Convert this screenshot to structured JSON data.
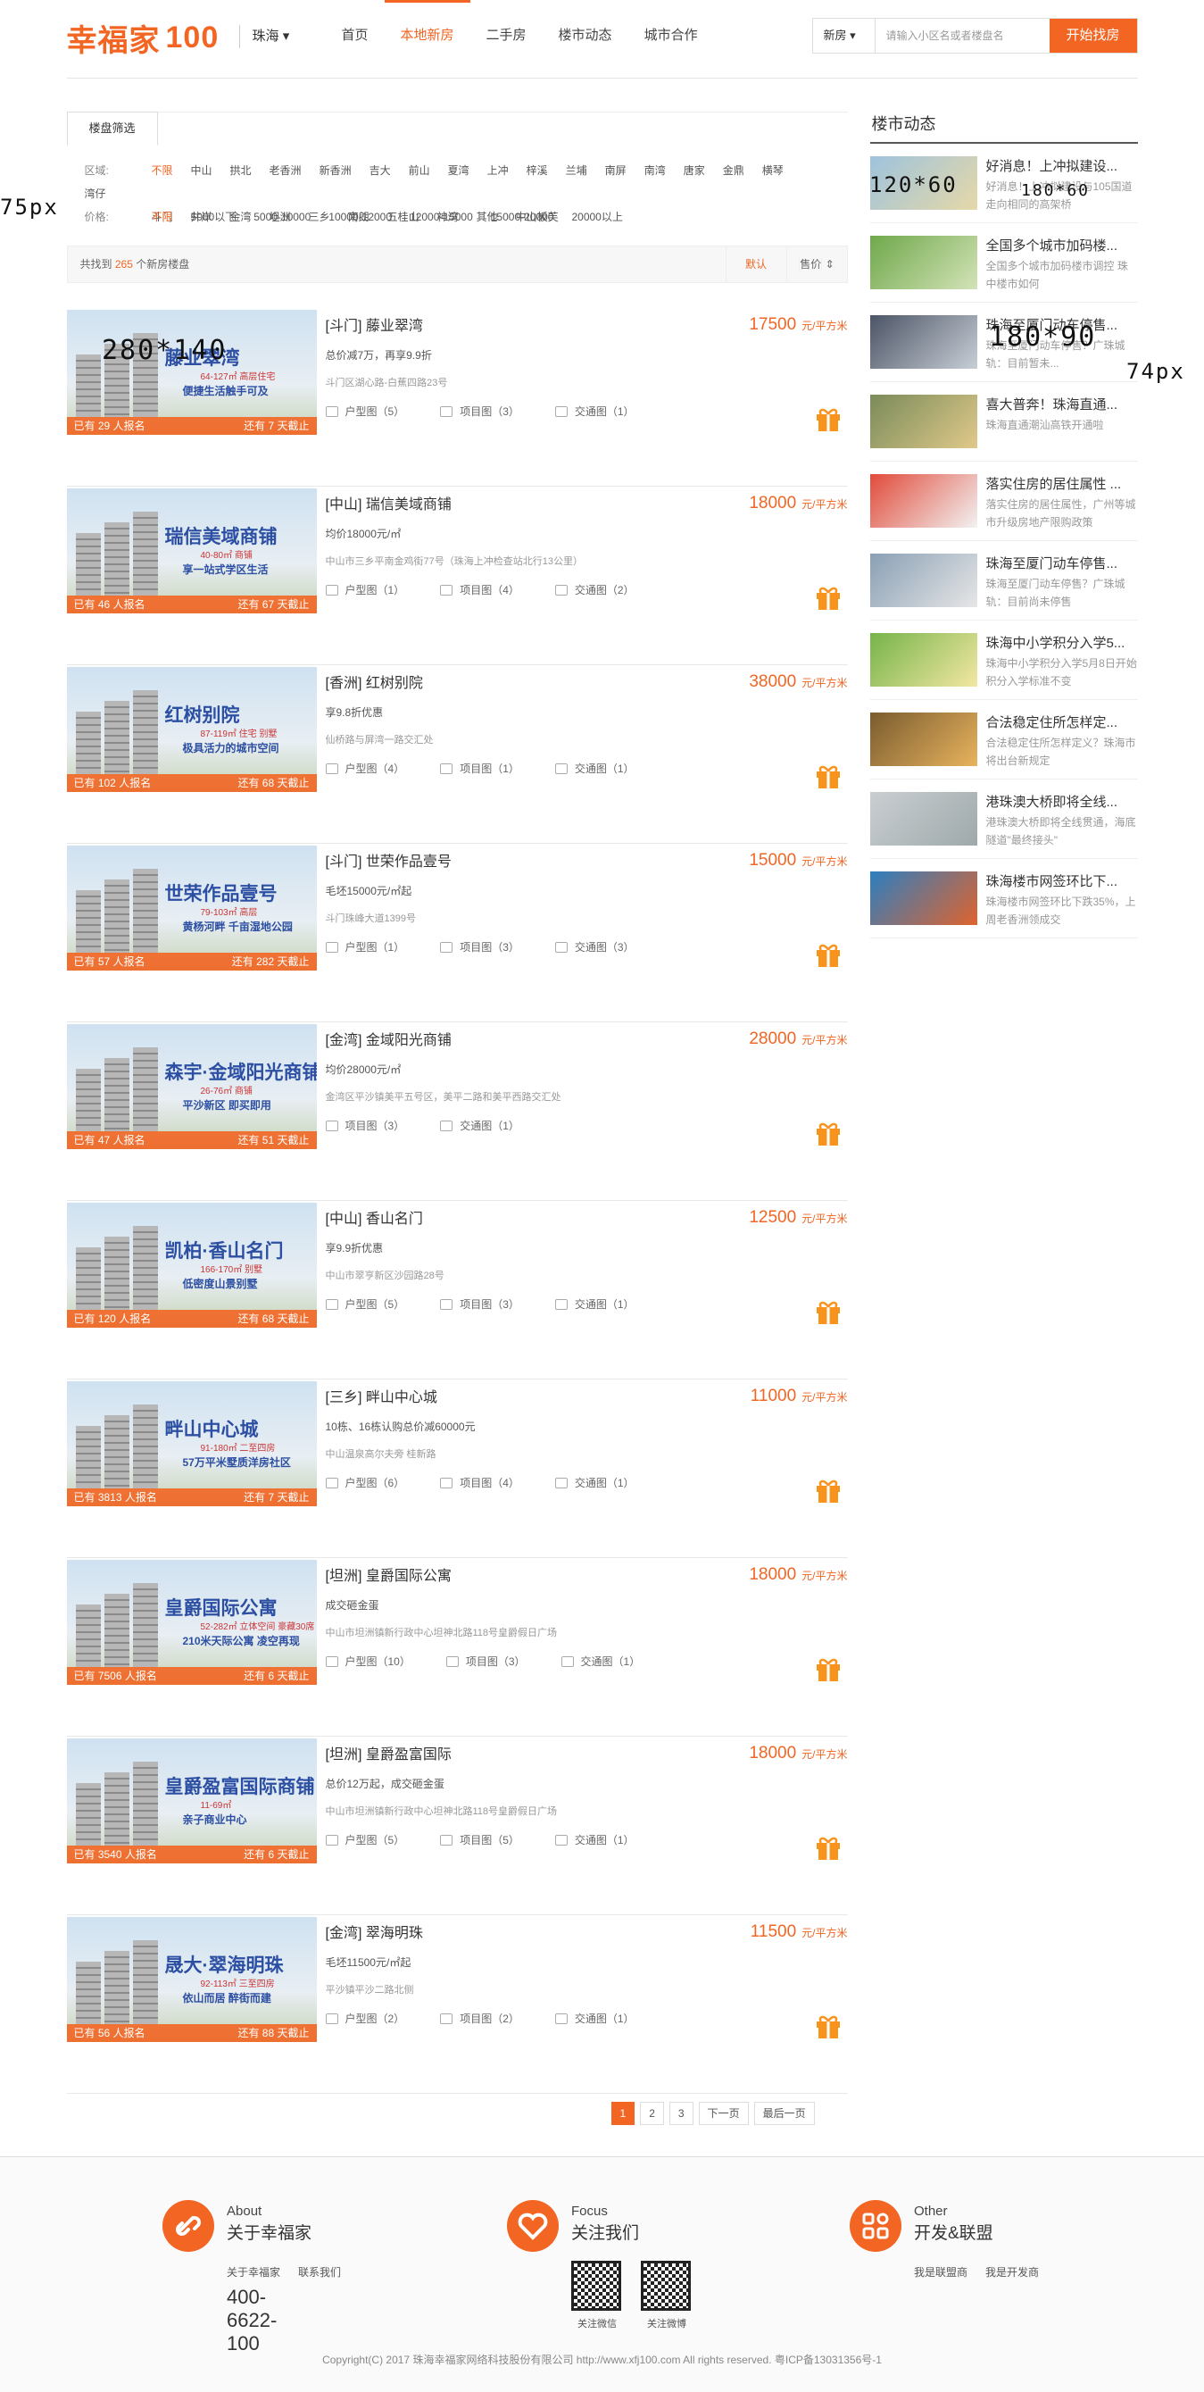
{
  "header": {
    "logo": "幸福家",
    "logo_num": "100",
    "city": "珠海",
    "nav": [
      "首页",
      "本地新房",
      "二手房",
      "楼市动态",
      "城市合作"
    ],
    "search": {
      "type": "新房",
      "placeholder": "请输入小区名或者楼盘名",
      "button": "开始找房"
    }
  },
  "filter": {
    "tab": "楼盘筛选",
    "area_label": "区域:",
    "areas": [
      "不限",
      "中山",
      "拱北",
      "老香洲",
      "新香洲",
      "吉大",
      "前山",
      "夏湾",
      "上冲",
      "梓溪",
      "兰埔",
      "南屏",
      "南湾",
      "唐家",
      "金鼎",
      "横琴",
      "湾仔",
      "斗门",
      "井岸",
      "金湾",
      "坦洲",
      "三乡",
      "南朗",
      "五桂山",
      "神湾",
      "其他",
      "中山板芙"
    ],
    "price_label": "价格:",
    "prices": [
      "不限",
      "5000以下",
      "5000-10000",
      "10000-12000",
      "12000-15000",
      "15000-20000",
      "20000以上"
    ],
    "found_pre": "共找到",
    "found_count": "265",
    "found_post": "个新房楼盘",
    "sort_default": "默认",
    "sort_price": "售价"
  },
  "listings": [
    {
      "pic_title": "藤业翠湾",
      "pic_sub": "64-127㎡ 高层住宅",
      "pic_slogan": "便捷生活触手可及",
      "signed": "已有 29 人报名",
      "left": "还有 7 天截止",
      "name": "[斗门] 藤业翠湾",
      "desc": "总价减7万，再享9.9折",
      "addr": "斗门区湖心路-白蕉四路23号",
      "tags": [
        "户型图（5）",
        "项目图（3）",
        "交通图（1）"
      ],
      "price": "17500",
      "unit": "元/平方米"
    },
    {
      "pic_title": "瑞信美域商铺",
      "pic_sub": "40-80㎡ 商铺",
      "pic_slogan": "享一站式学区生活",
      "signed": "已有 46 人报名",
      "left": "还有 67 天截止",
      "name": "[中山] 瑞信美域商铺",
      "desc": "均价18000元/㎡",
      "addr": "中山市三乡平南金鸡街77号（珠海上冲检查站北行13公里）",
      "tags": [
        "户型图（1）",
        "项目图（4）",
        "交通图（2）"
      ],
      "price": "18000",
      "unit": "元/平方米"
    },
    {
      "pic_title": "红树别院",
      "pic_sub": "87-119㎡ 住宅 别墅",
      "pic_slogan": "极具活力的城市空间",
      "signed": "已有 102 人报名",
      "left": "还有 68 天截止",
      "name": "[香洲] 红树别院",
      "desc": "享9.8折优惠",
      "addr": "仙桥路与屏湾一路交汇处",
      "tags": [
        "户型图（4）",
        "项目图（1）",
        "交通图（1）"
      ],
      "price": "38000",
      "unit": "元/平方米"
    },
    {
      "pic_title": "世荣作品壹号",
      "pic_sub": "79-103㎡ 高层",
      "pic_slogan": "黄杨河畔 千亩湿地公园",
      "signed": "已有 57 人报名",
      "left": "还有 282 天截止",
      "name": "[斗门] 世荣作品壹号",
      "desc": "毛坯15000元/㎡起",
      "addr": "斗门珠峰大道1399号",
      "tags": [
        "户型图（1）",
        "项目图（3）",
        "交通图（3）"
      ],
      "price": "15000",
      "unit": "元/平方米"
    },
    {
      "pic_title": "森宇·金域阳光商铺",
      "pic_sub": "26-76㎡ 商铺",
      "pic_slogan": "平沙新区 即买即用",
      "signed": "已有 47 人报名",
      "left": "还有 51 天截止",
      "name": "[金湾] 金域阳光商铺",
      "desc": "均价28000元/㎡",
      "addr": "金湾区平沙镇美平五号区，美平二路和美平西路交汇处",
      "tags": [
        "项目图（3）",
        "交通图（1）"
      ],
      "price": "28000",
      "unit": "元/平方米"
    },
    {
      "pic_title": "凯柏·香山名门",
      "pic_sub": "166-170㎡ 别墅",
      "pic_slogan": "低密度山景别墅",
      "signed": "已有 120 人报名",
      "left": "还有 68 天截止",
      "name": "[中山] 香山名门",
      "desc": "享9.9折优惠",
      "addr": "中山市翠亨新区沙园路28号",
      "tags": [
        "户型图（5）",
        "项目图（3）",
        "交通图（1）"
      ],
      "price": "12500",
      "unit": "元/平方米"
    },
    {
      "pic_title": "畔山中心城",
      "pic_sub": "91-180㎡ 二至四房",
      "pic_slogan": "57万平米墅质洋房社区",
      "signed": "已有 3813 人报名",
      "left": "还有 7 天截止",
      "name": "[三乡] 畔山中心城",
      "desc": "10栋、16栋认购总价减60000元",
      "addr": "中山温泉高尔夫旁 桂新路",
      "tags": [
        "户型图（6）",
        "项目图（4）",
        "交通图（1）"
      ],
      "price": "11000",
      "unit": "元/平方米"
    },
    {
      "pic_title": "皇爵国际公寓",
      "pic_sub": "52-282㎡ 立体空间 豪藏30席",
      "pic_slogan": "210米天际公寓 凌空再现",
      "signed": "已有 7506 人报名",
      "left": "还有 6 天截止",
      "name": "[坦洲] 皇爵国际公寓",
      "desc": "成交砸金蛋",
      "addr": "中山市坦洲镇新行政中心坦神北路118号皇爵假日广场",
      "tags": [
        "户型图（10）",
        "项目图（3）",
        "交通图（1）"
      ],
      "price": "18000",
      "unit": "元/平方米"
    },
    {
      "pic_title": "皇爵盈富国际商铺",
      "pic_sub": "11-69㎡",
      "pic_slogan": "亲子商业中心",
      "signed": "已有 3540 人报名",
      "left": "还有 6 天截止",
      "name": "[坦洲] 皇爵盈富国际",
      "desc": "总价12万起，成交砸金蛋",
      "addr": "中山市坦洲镇新行政中心坦神北路118号皇爵假日广场",
      "tags": [
        "户型图（5）",
        "项目图（5）",
        "交通图（1）"
      ],
      "price": "18000",
      "unit": "元/平方米"
    },
    {
      "pic_title": "晟大·翠海明珠",
      "pic_sub": "92-113㎡ 三至四房",
      "pic_slogan": "依山而居 醉街而建",
      "signed": "已有 56 人报名",
      "left": "还有 88 天截止",
      "name": "[金湾] 翠海明珠",
      "desc": "毛坯11500元/㎡起",
      "addr": "平沙镇平沙二路北侧",
      "tags": [
        "户型图（2）",
        "项目图（2）",
        "交通图（1）"
      ],
      "price": "11500",
      "unit": "元/平方米"
    }
  ],
  "pager": [
    "1",
    "2",
    "3",
    "下一页",
    "最后一页"
  ],
  "sidebar": {
    "title": "楼市动态",
    "news": [
      {
        "title": "好消息！上冲拟建设...",
        "desc": "好消息！上冲拟建设与105国道走向相同的高架桥"
      },
      {
        "title": "全国多个城市加码楼...",
        "desc": "全国多个城市加码楼市调控 珠中楼市如何"
      },
      {
        "title": "珠海至厦门动车停售...",
        "desc": "珠海至厦门动车停售？广珠城轨：目前暂未..."
      },
      {
        "title": "喜大普奔！珠海直通...",
        "desc": "珠海直通潮汕高铁开通啦"
      },
      {
        "title": "落实住房的居住属性 ...",
        "desc": "落实住房的居住属性，广州等城市升级房地产限购政策"
      },
      {
        "title": "珠海至厦门动车停售...",
        "desc": "珠海至厦门动车停售？广珠城轨：目前尚未停售"
      },
      {
        "title": "珠海中小学积分入学5...",
        "desc": "珠海中小学积分入学5月8日开始 积分入学标准不变"
      },
      {
        "title": "合法稳定住所怎样定...",
        "desc": "合法稳定住所怎样定义？珠海市将出台新规定"
      },
      {
        "title": "港珠澳大桥即将全线...",
        "desc": "港珠澳大桥即将全线贯通，海底隧道\"最终接头\""
      },
      {
        "title": "珠海楼市网签环比下...",
        "desc": "珠海楼市网签环比下跌35%，上周老香洲领成交"
      }
    ]
  },
  "footer": {
    "cols": [
      {
        "en": "About",
        "cn": "关于幸福家",
        "links": [
          "关于幸福家",
          "联系我们"
        ],
        "phone": "400-6622-100"
      },
      {
        "en": "Focus",
        "cn": "关注我们",
        "qr1": "关注微信",
        "qr2": "关注微博"
      },
      {
        "en": "Other",
        "cn": "开发&联盟",
        "links": [
          "我是联盟商",
          "我是开发商"
        ]
      }
    ],
    "copyright": "Copyright(C) 2017 珠海幸福家网络科技股份有限公司 http://www.xfj100.com All rights reserved. 粤ICP备13031356号-1"
  },
  "annotations": {
    "a1": "75px",
    "a2": "120*60",
    "a3": "180*60",
    "a4": "280*140",
    "a5": "180*90",
    "a6": "74px"
  },
  "colors": {
    "accent": "#f26522"
  }
}
